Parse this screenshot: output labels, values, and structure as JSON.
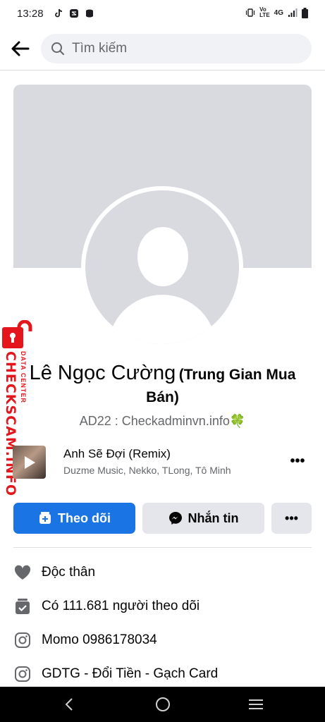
{
  "status_bar": {
    "time": "13:28",
    "network": "4G"
  },
  "header": {
    "search_placeholder": "Tìm kiếm"
  },
  "profile": {
    "name": "Lê Ngọc Cường",
    "name_suffix": "(Trung Gian Mua Bán)",
    "bio": "AD22 : Checkadminvn.info🍀"
  },
  "watermark": {
    "main": "CHECKSCAM.INFO",
    "sub": "DATA CENTER"
  },
  "music": {
    "title": "Anh Sẽ Đợi (Remix)",
    "artists": "Duzme Music, Nekko, TLong, Tô Minh",
    "more_label": "•••"
  },
  "actions": {
    "follow_label": "Theo dõi",
    "message_label": "Nhắn tin",
    "more_label": "•••"
  },
  "info": [
    {
      "icon": "heart-icon",
      "text": "Độc thân"
    },
    {
      "icon": "followers-icon",
      "text": "Có 111.681 người theo dõi"
    },
    {
      "icon": "instagram-icon",
      "text": "Momo 0986178034"
    },
    {
      "icon": "instagram-icon",
      "text": "GDTG - Đổi Tiền - Gạch Card"
    }
  ],
  "colors": {
    "primary": "#1b74e4",
    "secondary_button": "#e4e6eb",
    "watermark": "#e4161b"
  }
}
